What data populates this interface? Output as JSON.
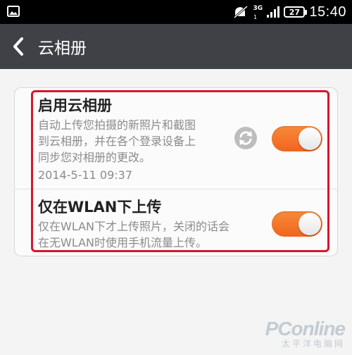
{
  "status_bar": {
    "time": "15:40",
    "battery": "27",
    "network_label": "3G",
    "icons": [
      "gallery-icon",
      "mute-icon",
      "signal-icon",
      "battery-icon"
    ]
  },
  "header": {
    "title": "云相册",
    "back_icon": "chevron-left-icon"
  },
  "settings": [
    {
      "title": "启用云相册",
      "description_lines": [
        "自动上传您拍摄的新照片和截图",
        "到云相册，并在各个登录设备上",
        "同步您对相册的更改。"
      ],
      "timestamp": "2014-5-11 09:37",
      "toggle_on": true,
      "extra_icon": "sync-icon"
    },
    {
      "title": "仅在WLAN下上传",
      "description_lines": [
        "仅在WLAN下才上传照片，关闭的话会",
        "在无WLAN时使用手机流量上传。"
      ],
      "toggle_on": true
    }
  ],
  "colors": {
    "accent": "#f0651d",
    "title_bar": "#3f4147",
    "highlight": "#d6162c"
  },
  "watermark": {
    "main": "PConline",
    "sub": "太平洋电脑网"
  }
}
